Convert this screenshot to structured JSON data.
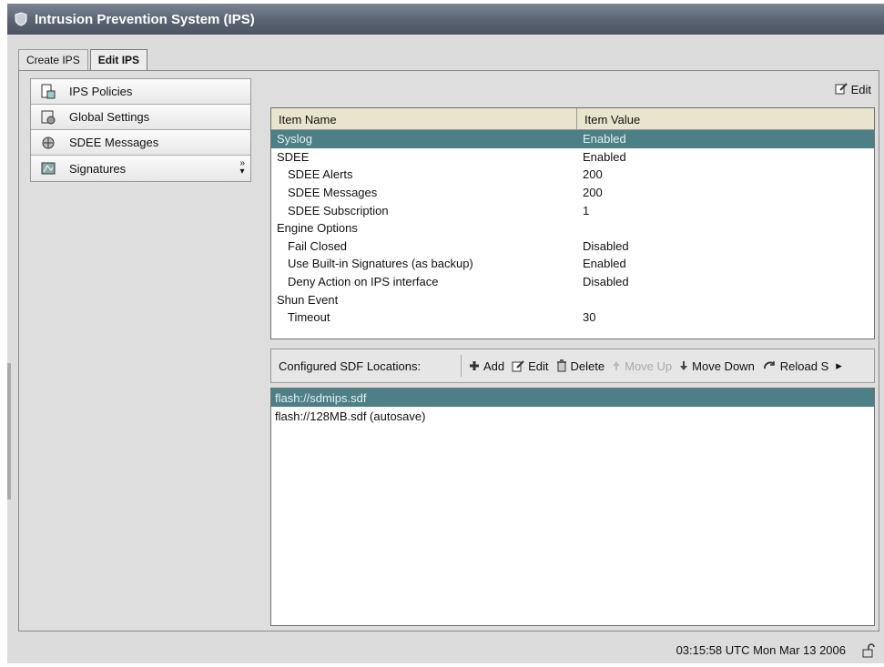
{
  "window": {
    "title": "Intrusion Prevention System (IPS)"
  },
  "tabs": [
    {
      "label": "Create IPS",
      "active": false
    },
    {
      "label": "Edit IPS",
      "active": true
    }
  ],
  "sidebar": {
    "items": [
      {
        "label": "IPS Policies",
        "icon": "policy-icon"
      },
      {
        "label": "Global Settings",
        "icon": "settings-icon"
      },
      {
        "label": "SDEE Messages",
        "icon": "messages-icon"
      },
      {
        "label": "Signatures",
        "icon": "signatures-icon"
      }
    ]
  },
  "toolbar": {
    "edit_label": "Edit"
  },
  "settings_table": {
    "columns": [
      "Item Name",
      "Item Value"
    ],
    "rows": [
      {
        "name": "Syslog",
        "value": "Enabled"
      },
      {
        "name": "SDEE",
        "value": "Enabled"
      },
      {
        "name": "SDEE Alerts",
        "value": "200"
      },
      {
        "name": "SDEE Messages",
        "value": "200"
      },
      {
        "name": "SDEE Subscription",
        "value": "1"
      },
      {
        "name": "Engine Options",
        "value": ""
      },
      {
        "name": "Fail Closed",
        "value": "Disabled"
      },
      {
        "name": "Use Built-in Signatures (as backup)",
        "value": "Enabled"
      },
      {
        "name": "Deny Action on IPS interface",
        "value": "Disabled"
      },
      {
        "name": "Shun Event",
        "value": ""
      },
      {
        "name": "Timeout",
        "value": "30"
      }
    ]
  },
  "sdf": {
    "label": "Configured SDF Locations:",
    "buttons": {
      "add": "Add",
      "edit": "Edit",
      "delete": "Delete",
      "move_up": "Move Up",
      "move_down": "Move Down",
      "reload": "Reload S"
    },
    "items": [
      "flash://sdmips.sdf",
      "flash://128MB.sdf  (autosave)"
    ]
  },
  "status": {
    "datetime": "03:15:58 UTC Mon Mar 13 2006"
  },
  "colors": {
    "selection": "#4c7f86",
    "title_bar": "#5d6674",
    "table_header": "#e9e5cc"
  }
}
